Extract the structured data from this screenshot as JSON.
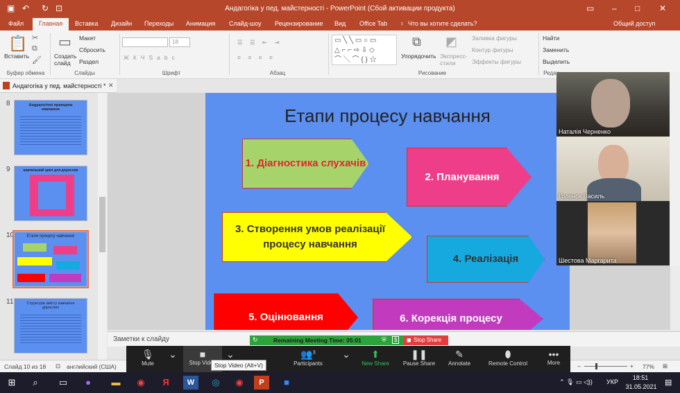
{
  "window": {
    "title": "Андагогіка у пед. майстерності - PowerPoint (Сбой активации продукта)"
  },
  "tabs": [
    "Файл",
    "Главная",
    "Вставка",
    "Дизайн",
    "Переходы",
    "Анимация",
    "Слайд-шоу",
    "Рецензирование",
    "Вид",
    "Office Tab",
    "Что вы хотите сделать?",
    "Общий доступ"
  ],
  "ribbon": {
    "groups": [
      "Буфер обмена",
      "Слайды",
      "Шрифт",
      "Абзац",
      "Рисование",
      "Редак"
    ],
    "paste": "Вставить",
    "create_slide": "Создать слайд",
    "layout": "Макет",
    "reset": "Сбросить",
    "section": "Раздел",
    "font_size": "18",
    "arrange": "Упорядочить",
    "express_styles": "Экспресс-стили",
    "fill": "Заливка фигуры",
    "outline": "Контур фигуры",
    "effects": "Эффекты фигуры",
    "find": "Найти",
    "replace": "Заменить",
    "select": "Выделить"
  },
  "doc_tab": "Андагогіка у пед. майстерності *",
  "thumbnails": [
    {
      "num": "8",
      "title": "Андрагогічні принципи навчання"
    },
    {
      "num": "9",
      "title": "навчальний цикл для дорослих"
    },
    {
      "num": "10",
      "title": "Етапи процесу навчання"
    },
    {
      "num": "11",
      "title": "Структура змісту навчання дорослих"
    }
  ],
  "slide": {
    "title": "Етапи процесу навчання",
    "shapes": [
      {
        "text": "1. Діагностика слухачів",
        "color": "#a6d46b",
        "text_color": "#e4262b"
      },
      {
        "text": "2. Планування",
        "color": "#ee3e8a",
        "text_color": "#ffffff"
      },
      {
        "text": "3. Створення умов реалізації процесу навчання",
        "color": "#ffff00",
        "text_color": "#333333"
      },
      {
        "text": "4. Реалізація",
        "color": "#16a9e0",
        "text_color": "#333333"
      },
      {
        "text": "5. Оцінювання",
        "color": "#ff0000",
        "text_color": "#ffffff"
      },
      {
        "text": "6. Корекція процесу",
        "color": "#c23bbf",
        "text_color": "#ffffff"
      }
    ]
  },
  "notes_placeholder": "Заметки к слайду",
  "status": {
    "slide": "Слайд 10 из 18",
    "lang": "английский (США)",
    "zoom": "77%"
  },
  "meeting": {
    "remaining": "Remaining Meeting Time: 05:01",
    "stop_share": "Stop Share"
  },
  "zoom_toolbar": [
    "Mute",
    "Stop Video",
    "Participants",
    "New Share",
    "Pause Share",
    "Annotate",
    "Remote Control",
    "More"
  ],
  "participants_count": "3",
  "tooltip": "Stop Video (Alt+V)",
  "participants": [
    "Наталія Черненко",
    "Голенок Василь",
    "Шестова Маргарита"
  ],
  "taskbar": {
    "lang": "УКР",
    "time": "18:51",
    "date": "31.05.2021"
  }
}
